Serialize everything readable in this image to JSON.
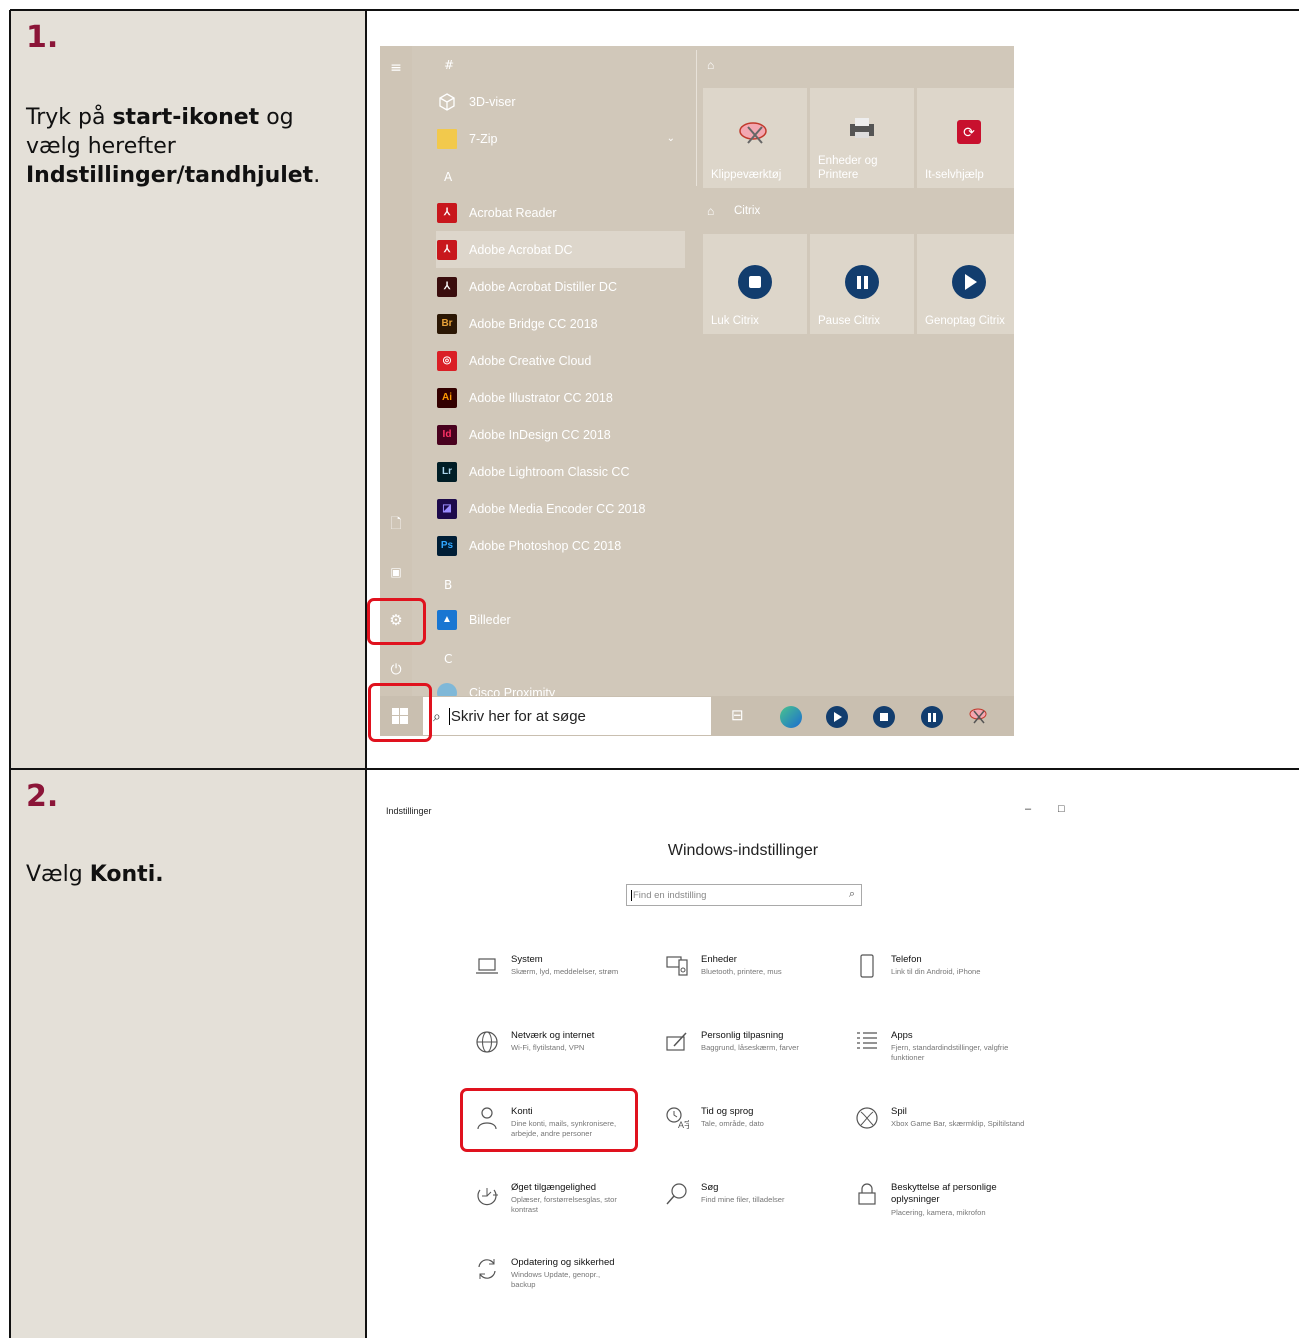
{
  "step1": {
    "number": "1.",
    "text_a": "Tryk på ",
    "text_b": "start-ikonet",
    "text_c": " og vælg herefter ",
    "text_d": "Indstillinger/tandhjulet",
    "text_e": "."
  },
  "step2": {
    "number": "2.",
    "text_a": "Vælg ",
    "text_b": "Konti."
  },
  "start_menu": {
    "headers": [
      "#",
      "A",
      "B",
      "C"
    ],
    "apps": [
      {
        "label": "3D-viser",
        "icon": "cube-icon",
        "color": "#d1c8ba"
      },
      {
        "label": "7-Zip",
        "icon": "folder-icon",
        "color": "#f2c94c"
      },
      {
        "label": "Acrobat Reader",
        "icon": "acrobat-reader-icon",
        "color": "#c8171d"
      },
      {
        "label": "Adobe Acrobat DC",
        "icon": "acrobat-dc-icon",
        "color": "#c8171d"
      },
      {
        "label": "Adobe Acrobat Distiller DC",
        "icon": "distiller-icon",
        "color": "#3a0d0d"
      },
      {
        "label": "Adobe Bridge CC 2018",
        "icon": "bridge-icon",
        "color": "#2b1704",
        "abbr": "Br"
      },
      {
        "label": "Adobe Creative Cloud",
        "icon": "creative-cloud-icon",
        "color": "#da1f26"
      },
      {
        "label": "Adobe Illustrator CC 2018",
        "icon": "illustrator-icon",
        "color": "#330000",
        "abbr": "Ai"
      },
      {
        "label": "Adobe InDesign CC 2018",
        "icon": "indesign-icon",
        "color": "#49021f",
        "abbr": "Id"
      },
      {
        "label": "Adobe Lightroom Classic CC",
        "icon": "lightroom-icon",
        "color": "#001d26",
        "abbr": "Lr"
      },
      {
        "label": "Adobe Media Encoder CC 2018",
        "icon": "media-encoder-icon",
        "color": "#1d0a4b"
      },
      {
        "label": "Adobe Photoshop CC 2018",
        "icon": "photoshop-icon",
        "color": "#001e36",
        "abbr": "Ps"
      },
      {
        "label": "Billeder",
        "icon": "photos-icon",
        "color": "#1976d2"
      },
      {
        "label": "Cisco Proximity",
        "icon": "cisco-icon",
        "color": "#7fb8d8"
      }
    ],
    "group_citrix": "Citrix",
    "tiles_top": [
      "Klippeværktøj",
      "Enheder og Printere",
      "It-selvhjælp"
    ],
    "tiles_citrix": [
      "Luk Citrix",
      "Pause Citrix",
      "Genoptag Citrix"
    ],
    "search_placeholder": "Skriv her for at søge"
  },
  "settings": {
    "window_title": "Indstillinger",
    "heading": "Windows-indstillinger",
    "search_placeholder": "Find en indstilling",
    "categories": [
      {
        "title": "System",
        "sub": "Skærm, lyd, meddelelser, strøm",
        "icon": "laptop-icon"
      },
      {
        "title": "Enheder",
        "sub": "Bluetooth, printere, mus",
        "icon": "devices-icon"
      },
      {
        "title": "Telefon",
        "sub": "Link til din Android, iPhone",
        "icon": "phone-icon"
      },
      {
        "title": "Netværk og internet",
        "sub": "Wi-Fi, flytilstand, VPN",
        "icon": "globe-icon"
      },
      {
        "title": "Personlig tilpasning",
        "sub": "Baggrund, låseskærm, farver",
        "icon": "paint-icon"
      },
      {
        "title": "Apps",
        "sub": "Fjern, standardindstillinger, valgfrie funktioner",
        "icon": "apps-list-icon"
      },
      {
        "title": "Konti",
        "sub": "Dine konti, mails, synkronisere, arbejde, andre personer",
        "icon": "person-icon"
      },
      {
        "title": "Tid og sprog",
        "sub": "Tale, område, dato",
        "icon": "time-language-icon"
      },
      {
        "title": "Spil",
        "sub": "Xbox Game Bar, skærmklip, Spiltilstand",
        "icon": "xbox-icon"
      },
      {
        "title": "Øget tilgængelighed",
        "sub": "Oplæser, forstørrelsesglas, stor kontrast",
        "icon": "ease-of-access-icon"
      },
      {
        "title": "Søg",
        "sub": "Find mine filer, tilladelser",
        "icon": "search-icon"
      },
      {
        "title": "Beskyttelse af personlige oplysninger",
        "sub": "Placering, kamera, mikrofon",
        "icon": "lock-icon"
      },
      {
        "title": "Opdatering og sikkerhed",
        "sub": "Windows Update, genopr., backup",
        "icon": "update-icon"
      }
    ]
  },
  "colors": {
    "step_number": "#8b1538",
    "highlight": "#e0121e",
    "cell_bg": "#e4e0d8",
    "citrix_blue": "#123d6e"
  }
}
